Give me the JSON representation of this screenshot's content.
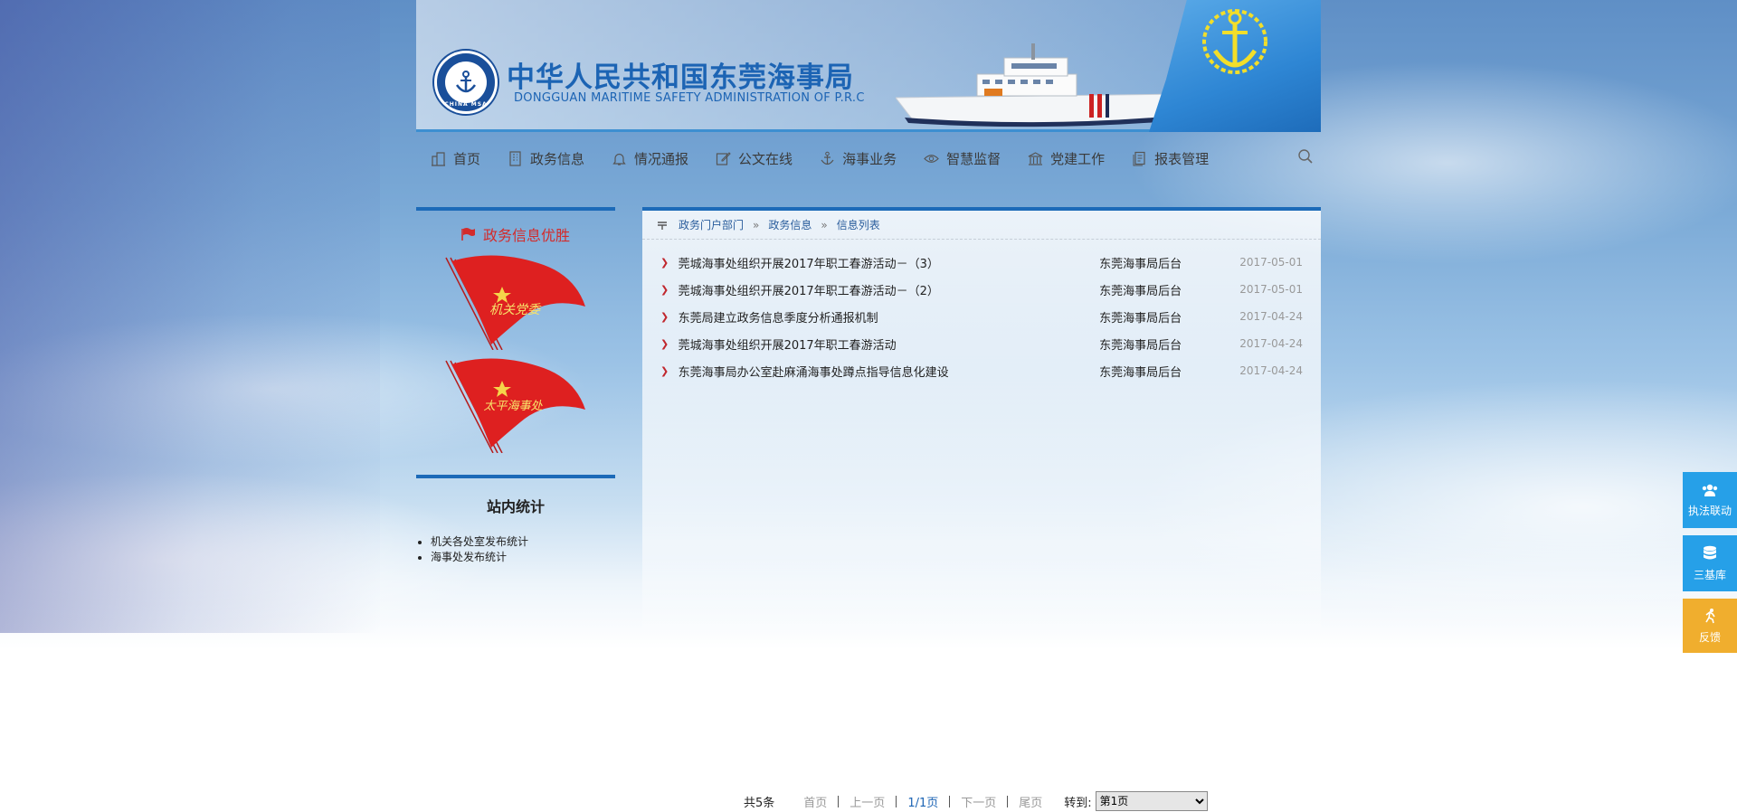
{
  "header": {
    "title_cn": "中华人民共和国东莞海事局",
    "title_en": "DONGGUAN MARITIME SAFETY ADMINISTRATION OF P.R.C",
    "logo_text": "CHINA MSA"
  },
  "nav": {
    "items": [
      {
        "label": "首页",
        "icon": "home-icon"
      },
      {
        "label": "政务信息",
        "icon": "building-icon"
      },
      {
        "label": "情况通报",
        "icon": "bell-icon"
      },
      {
        "label": "公文在线",
        "icon": "edit-icon"
      },
      {
        "label": "海事业务",
        "icon": "anchor-icon"
      },
      {
        "label": "智慧监督",
        "icon": "eye-icon"
      },
      {
        "label": "党建工作",
        "icon": "bank-icon"
      },
      {
        "label": "报表管理",
        "icon": "report-icon"
      }
    ],
    "search_icon": "search-icon"
  },
  "left": {
    "panel_title": "政务信息优胜",
    "flags": [
      "机关党委",
      "太平海事处"
    ],
    "stats_title": "站内统计",
    "stats_links": [
      "机关各处室发布统计",
      "海事处发布统计"
    ]
  },
  "breadcrumb": {
    "items": [
      "政务门户部门",
      "政务信息",
      "信息列表"
    ],
    "separator": "»"
  },
  "news": [
    {
      "title": "莞城海事处组织开展2017年职工春游活动－（3）",
      "source": "东莞海事局后台",
      "date": "2017-05-01"
    },
    {
      "title": "莞城海事处组织开展2017年职工春游活动－（2）",
      "source": "东莞海事局后台",
      "date": "2017-05-01"
    },
    {
      "title": "东莞局建立政务信息季度分析通报机制",
      "source": "东莞海事局后台",
      "date": "2017-04-24"
    },
    {
      "title": "莞城海事处组织开展2017年职工春游活动",
      "source": "东莞海事局后台",
      "date": "2017-04-24"
    },
    {
      "title": "东莞海事局办公室赴麻涌海事处蹲点指导信息化建设",
      "source": "东莞海事局后台",
      "date": "2017-04-24"
    }
  ],
  "pager": {
    "total": "共5条",
    "first": "首页",
    "prev": "上一页",
    "current": "1/1页",
    "next": "下一页",
    "last": "尾页",
    "goto_label": "转到:",
    "goto_value": "第1页"
  },
  "side_float": [
    {
      "label": "执法联动",
      "icon": "users-icon"
    },
    {
      "label": "三基库",
      "icon": "database-icon"
    },
    {
      "label": "反馈",
      "icon": "run-icon"
    }
  ],
  "colors": {
    "brand_blue": "#1c6ab8",
    "accent_red": "#c0262d",
    "float_blue": "#26a0e8",
    "float_orange": "#f0ae2e"
  }
}
